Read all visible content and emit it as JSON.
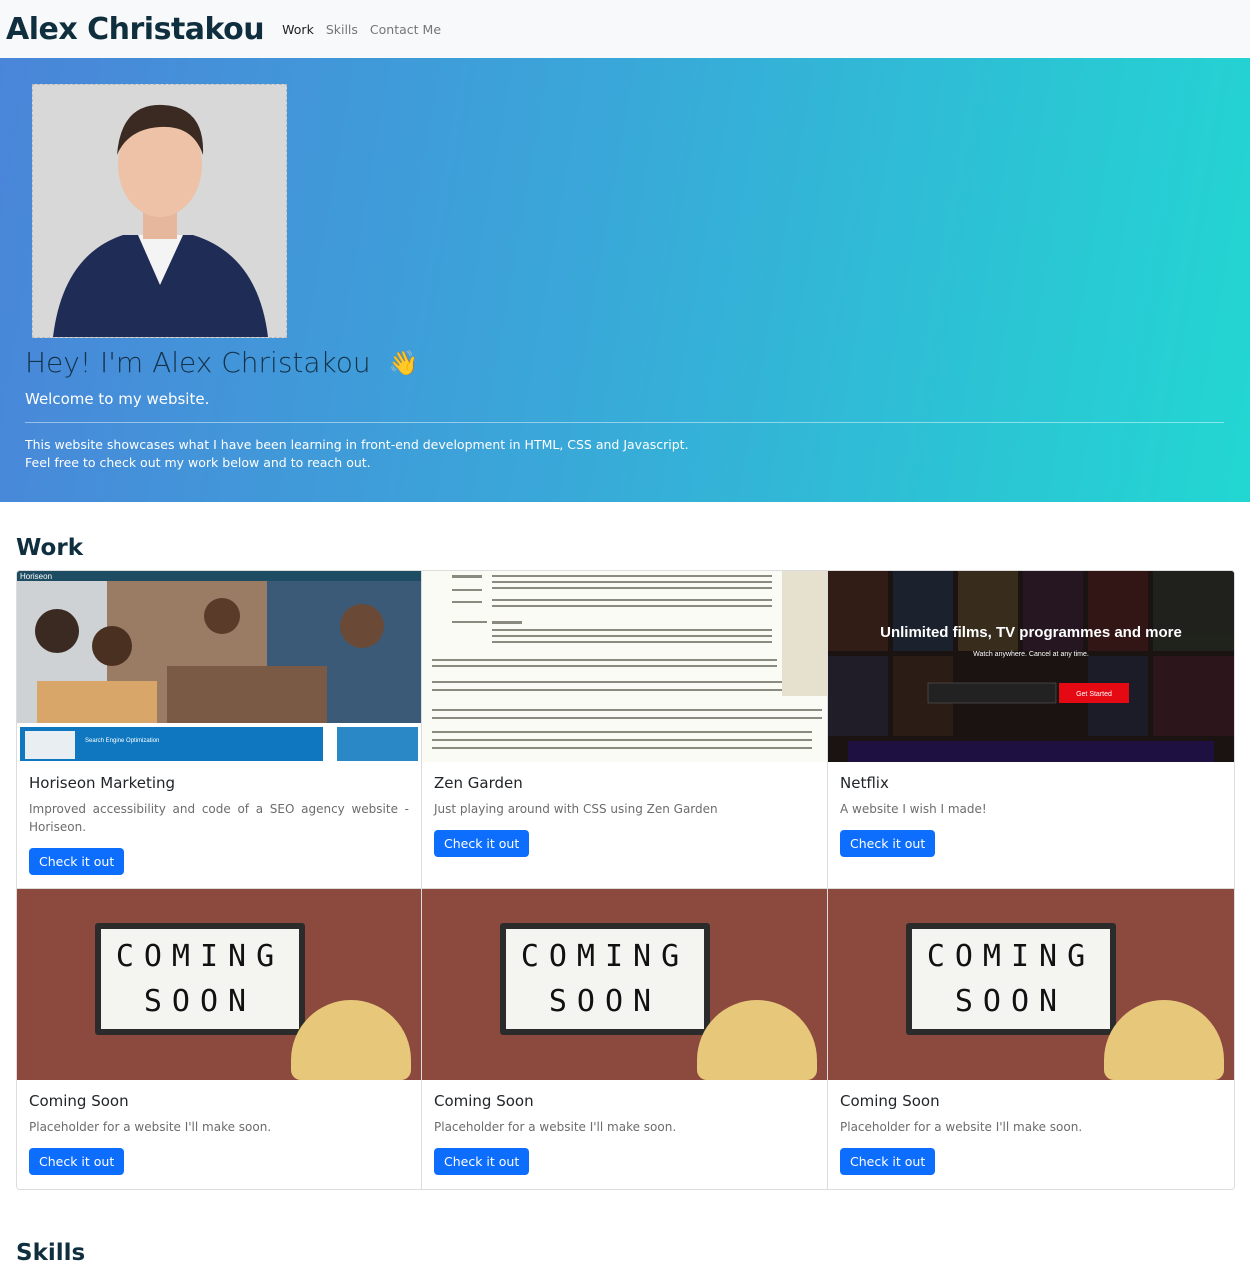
{
  "nav": {
    "brand": "Alex Christakou",
    "links": [
      "Work",
      "Skills",
      "Contact Me"
    ]
  },
  "hero": {
    "title": "Hey! I'm Alex Christakou",
    "emoji": "👋",
    "subtitle": "Welcome to my website.",
    "description_line1": "This website showcases what I have been learning in front-end development in HTML, CSS and Javascript.",
    "description_line2": "Feel free to check out my work below and to reach out."
  },
  "sections": {
    "work": "Work",
    "skills": "Skills"
  },
  "projects": [
    {
      "title": "Horiseon Marketing",
      "text": "Improved accessibility and code of a SEO agency website - Horiseon.",
      "button": "Check it out"
    },
    {
      "title": "Zen Garden",
      "text": "Just playing around with CSS using Zen Garden",
      "button": "Check it out"
    },
    {
      "title": "Netflix",
      "text": "A website I wish I made!",
      "button": "Check it out"
    },
    {
      "title": "Coming Soon",
      "text": "Placeholder for a website I'll make soon.",
      "button": "Check it out"
    },
    {
      "title": "Coming Soon",
      "text": "Placeholder for a website I'll make soon.",
      "button": "Check it out"
    },
    {
      "title": "Coming Soon",
      "text": "Placeholder for a website I'll make soon.",
      "button": "Check it out"
    }
  ],
  "image_text": {
    "horiseon_logo": "Horiseon",
    "horiseon_seo": "Search Engine Optimization",
    "netflix_headline": "Unlimited films, TV programmes and more",
    "netflix_sub": "Watch anywhere. Cancel at any time.",
    "netflix_cta": "Get Started",
    "coming_line1": "COMING",
    "coming_line2": "SOON"
  },
  "colors": {
    "primary": "#0d6efd",
    "hero_start": "#4a85d9",
    "hero_end": "#22d7d2",
    "brand": "#0f2f3f"
  }
}
